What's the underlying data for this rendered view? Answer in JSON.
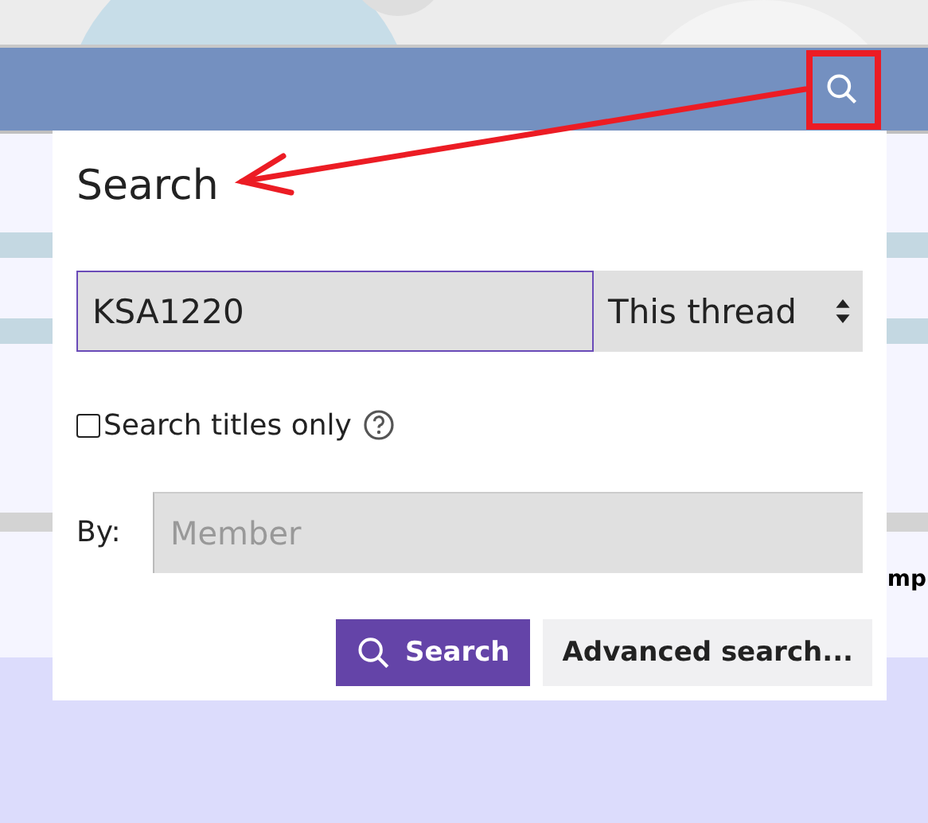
{
  "page": {
    "cut_text": "mp"
  },
  "search_popup": {
    "title": "Search",
    "query": {
      "value": "KSA1220"
    },
    "scope": {
      "value": "This thread"
    },
    "titles_only": {
      "label": "Search titles only",
      "checked": false
    },
    "by": {
      "label": "By:",
      "placeholder": "Member"
    },
    "buttons": [
      {
        "label": "Search",
        "kind": "primary"
      },
      {
        "label": "Advanced search...",
        "kind": "secondary"
      }
    ]
  }
}
